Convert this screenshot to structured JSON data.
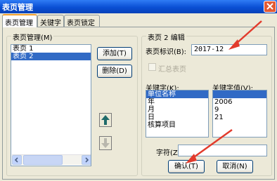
{
  "window": {
    "title": "表页管理"
  },
  "tabs": [
    {
      "label": "表页管理"
    },
    {
      "label": "关键字"
    },
    {
      "label": "表页锁定"
    }
  ],
  "sheet_list": {
    "group_label": "表页管理(M)",
    "items": [
      "表页 1",
      "表页 2"
    ],
    "selected_index": 1
  },
  "buttons": {
    "add": "添加(T)",
    "delete": "删除(D)",
    "ok": "确认(T)",
    "cancel": "取消(N)"
  },
  "edit": {
    "group_label": "表页 2 编辑",
    "sheet_id_label": "表页标识(B):",
    "sheet_id_value": "2017-12",
    "summary_label": "汇总表页",
    "keyword_label": "关键字(K):",
    "keyword_value_label": "关键字值(V):",
    "keywords": [
      "单位名称",
      "年",
      "月",
      "日",
      "核算项目"
    ],
    "keyword_values": [
      "",
      "2006",
      "9",
      "21",
      ""
    ],
    "selected_keyword_index": 0,
    "char_label": "字符(Z)",
    "char_value": ""
  },
  "icons": {
    "move_up": "arrow-up-icon",
    "move_down": "arrow-down-icon",
    "scroll_left": "chevron-left-icon",
    "scroll_right": "chevron-right-icon",
    "close": "close-icon"
  }
}
